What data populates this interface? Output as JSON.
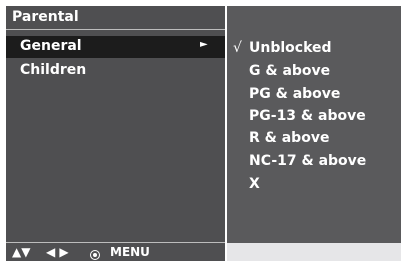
{
  "left": {
    "title": "Parental",
    "items": [
      {
        "label": "General",
        "selected": true
      },
      {
        "label": "Children",
        "selected": false
      }
    ],
    "footer": {
      "updown": "▲▼",
      "leftright": "◀ ▶",
      "menu": "MENU"
    }
  },
  "right": {
    "check_mark": "√",
    "options": [
      {
        "label": "Unblocked",
        "checked": true
      },
      {
        "label": "G & above",
        "checked": false
      },
      {
        "label": "PG & above",
        "checked": false
      },
      {
        "label": "PG-13 & above",
        "checked": false
      },
      {
        "label": "R & above",
        "checked": false
      },
      {
        "label": "NC-17 & above",
        "checked": false
      },
      {
        "label": "X",
        "checked": false
      }
    ]
  },
  "colors": {
    "panel_bg": "#4f4f51",
    "selected_bg": "#1c1c1c",
    "submenu_bg": "#5a5a5c",
    "text": "#ffffff"
  }
}
